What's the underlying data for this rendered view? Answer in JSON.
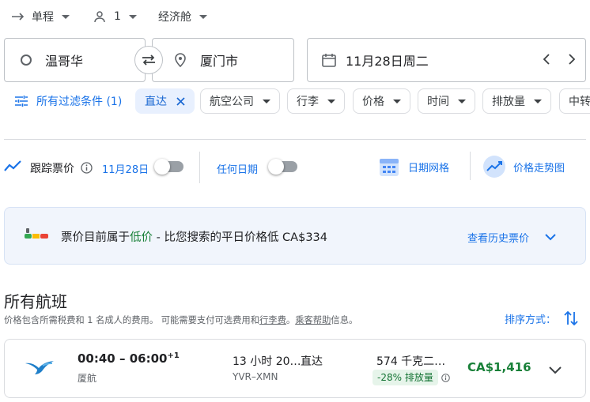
{
  "top_bar": {
    "trip_type": "单程",
    "passengers": "1",
    "cabin_class": "经济舱"
  },
  "search": {
    "origin": "温哥华",
    "destination": "厦门市",
    "date": "11月28日周二"
  },
  "filters": {
    "all_filters": "所有过滤条件 (1)",
    "chips": [
      "直达",
      "航空公司",
      "行李",
      "价格",
      "时间",
      "排放量",
      "中转"
    ]
  },
  "tracking": {
    "track_label": "跟踪票价",
    "track_date": "11月28日",
    "any_date": "任何日期",
    "date_grid": "日期网格",
    "price_graph": "价格走势图"
  },
  "insight": {
    "text_prefix": "票价目前属于",
    "level": "低价",
    "text_suffix": " - 比您搜索的平日价格低 CA$334",
    "history_link": "查看历史票价"
  },
  "results": {
    "heading": "所有航班",
    "note_1": "价格包含所需税费和 1 名成人的费用。 可能需要支付可选费用和",
    "note_link_1": "行李费",
    "note_2": "。",
    "note_link_2": "乘客帮助",
    "note_3": "信息。",
    "sort_label": "排序方式："
  },
  "flights": [
    {
      "times": "00:40 – 06:00",
      "day_offset": "+1",
      "airline": "厦航",
      "duration": "13 小时 20…",
      "stops": "直达",
      "route": "YVR–XMN",
      "emissions": "574 千克二…",
      "emissions_badge": "-28% 排放量",
      "price": "CA$1,416"
    }
  ],
  "colors": {
    "accent": "#1a73e8",
    "price_green": "#188038",
    "chip_selected_bg": "#e8f0fe",
    "insight_bg": "#f1f5fc"
  }
}
